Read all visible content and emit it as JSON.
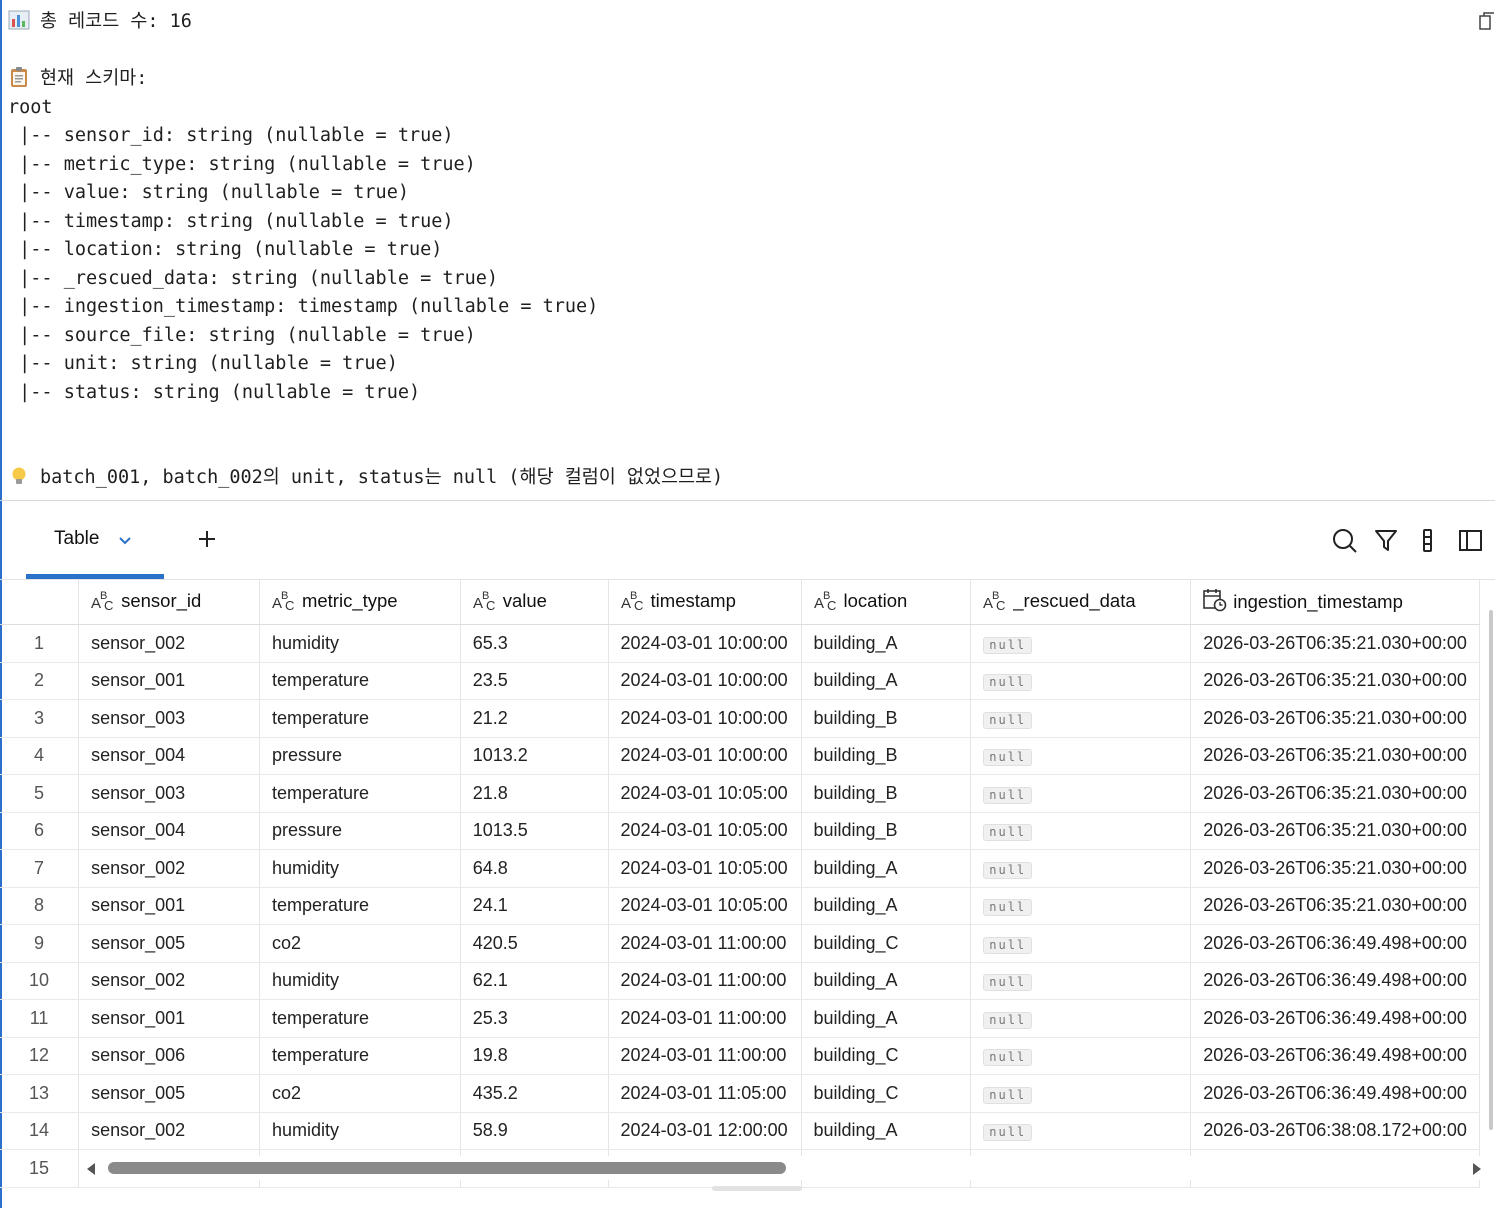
{
  "output": {
    "record_count_line": "총 레코드 수: 16",
    "schema_title": "현재 스키마:",
    "schema_lines": [
      "root",
      " |-- sensor_id: string (nullable = true)",
      " |-- metric_type: string (nullable = true)",
      " |-- value: string (nullable = true)",
      " |-- timestamp: string (nullable = true)",
      " |-- location: string (nullable = true)",
      " |-- _rescued_data: string (nullable = true)",
      " |-- ingestion_timestamp: timestamp (nullable = true)",
      " |-- source_file: string (nullable = true)",
      " |-- unit: string (nullable = true)",
      " |-- status: string (nullable = true)"
    ],
    "note_line": "batch_001, batch_002의 unit, status는 null (해당 컬럼이 없었으므로)",
    "icons": {
      "count": "bar-chart-emoji",
      "schema": "clipboard-emoji",
      "note": "lightbulb-emoji",
      "copy": "copy-icon"
    }
  },
  "toolbar": {
    "tab_label": "Table",
    "add_label": "+",
    "tools": [
      "search-icon",
      "filter-icon",
      "column-settings-icon",
      "sidebar-toggle-icon"
    ]
  },
  "table": {
    "columns": [
      {
        "name": "sensor_id",
        "type": "string"
      },
      {
        "name": "metric_type",
        "type": "string"
      },
      {
        "name": "value",
        "type": "string"
      },
      {
        "name": "timestamp",
        "type": "string"
      },
      {
        "name": "location",
        "type": "string"
      },
      {
        "name": "_rescued_data",
        "type": "string"
      },
      {
        "name": "ingestion_timestamp",
        "type": "timestamp"
      }
    ],
    "rows": [
      [
        "1",
        "sensor_002",
        "humidity",
        "65.3",
        "2024-03-01 10:00:00",
        "building_A",
        "null",
        "2026-03-26T06:35:21.030+00:00"
      ],
      [
        "2",
        "sensor_001",
        "temperature",
        "23.5",
        "2024-03-01 10:00:00",
        "building_A",
        "null",
        "2026-03-26T06:35:21.030+00:00"
      ],
      [
        "3",
        "sensor_003",
        "temperature",
        "21.2",
        "2024-03-01 10:00:00",
        "building_B",
        "null",
        "2026-03-26T06:35:21.030+00:00"
      ],
      [
        "4",
        "sensor_004",
        "pressure",
        "1013.2",
        "2024-03-01 10:00:00",
        "building_B",
        "null",
        "2026-03-26T06:35:21.030+00:00"
      ],
      [
        "5",
        "sensor_003",
        "temperature",
        "21.8",
        "2024-03-01 10:05:00",
        "building_B",
        "null",
        "2026-03-26T06:35:21.030+00:00"
      ],
      [
        "6",
        "sensor_004",
        "pressure",
        "1013.5",
        "2024-03-01 10:05:00",
        "building_B",
        "null",
        "2026-03-26T06:35:21.030+00:00"
      ],
      [
        "7",
        "sensor_002",
        "humidity",
        "64.8",
        "2024-03-01 10:05:00",
        "building_A",
        "null",
        "2026-03-26T06:35:21.030+00:00"
      ],
      [
        "8",
        "sensor_001",
        "temperature",
        "24.1",
        "2024-03-01 10:05:00",
        "building_A",
        "null",
        "2026-03-26T06:35:21.030+00:00"
      ],
      [
        "9",
        "sensor_005",
        "co2",
        "420.5",
        "2024-03-01 11:00:00",
        "building_C",
        "null",
        "2026-03-26T06:36:49.498+00:00"
      ],
      [
        "10",
        "sensor_002",
        "humidity",
        "62.1",
        "2024-03-01 11:00:00",
        "building_A",
        "null",
        "2026-03-26T06:36:49.498+00:00"
      ],
      [
        "11",
        "sensor_001",
        "temperature",
        "25.3",
        "2024-03-01 11:00:00",
        "building_A",
        "null",
        "2026-03-26T06:36:49.498+00:00"
      ],
      [
        "12",
        "sensor_006",
        "temperature",
        "19.8",
        "2024-03-01 11:00:00",
        "building_C",
        "null",
        "2026-03-26T06:36:49.498+00:00"
      ],
      [
        "13",
        "sensor_005",
        "co2",
        "435.2",
        "2024-03-01 11:05:00",
        "building_C",
        "null",
        "2026-03-26T06:36:49.498+00:00"
      ],
      [
        "14",
        "sensor_002",
        "humidity",
        "58.9",
        "2024-03-01 12:00:00",
        "building_A",
        "null",
        "2026-03-26T06:38:08.172+00:00"
      ],
      [
        "15",
        "",
        "",
        "",
        "",
        "",
        "",
        ""
      ]
    ]
  },
  "colors": {
    "accent": "#2a72c9",
    "scroll_thumb": "#8a8a8a"
  }
}
